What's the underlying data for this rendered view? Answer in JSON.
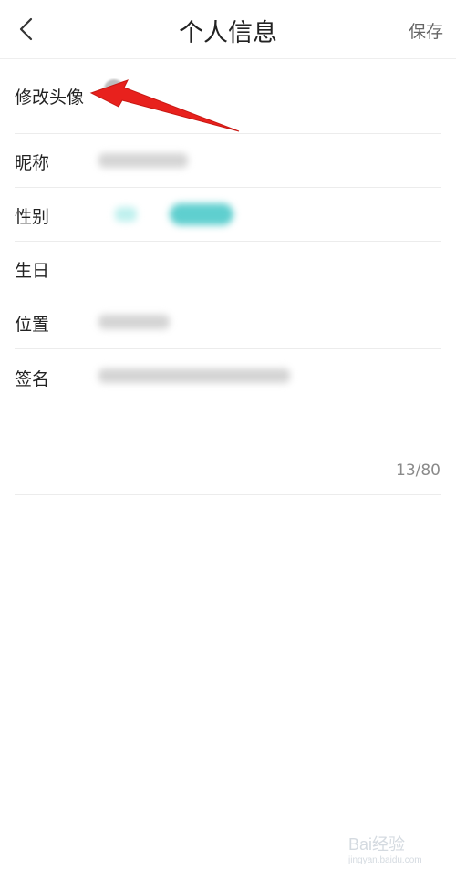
{
  "header": {
    "title": "个人信息",
    "save_label": "保存"
  },
  "fields": [
    {
      "label": "修改头像"
    },
    {
      "label": "昵称"
    },
    {
      "label": "性别"
    },
    {
      "label": "生日"
    },
    {
      "label": "位置"
    },
    {
      "label": "签名"
    }
  ],
  "signature_counter": "13/80",
  "watermark": {
    "brand": "Bai经验",
    "url": "jingyan.baidu.com"
  },
  "colors": {
    "arrow": "#e8211d",
    "gender_chip": "#5fcfcf"
  },
  "icons": {
    "back": "chevron-left-icon"
  }
}
